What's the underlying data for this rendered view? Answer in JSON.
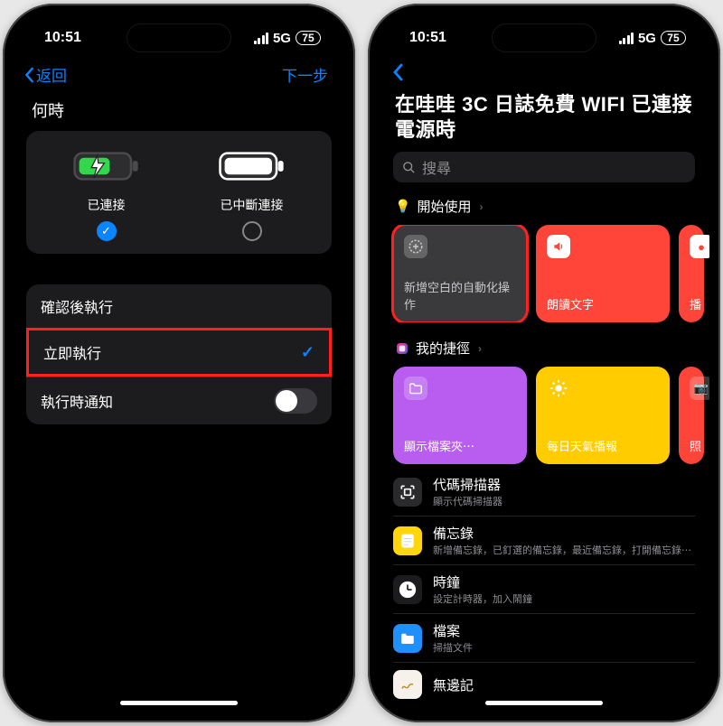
{
  "status": {
    "time": "10:51",
    "network": "5G",
    "battery": "75"
  },
  "left": {
    "back": "返回",
    "next": "下一步",
    "when": "何時",
    "connected": "已連接",
    "disconnected": "已中斷連接",
    "row_confirm": "確認後執行",
    "row_immediate": "立即執行",
    "row_notify": "執行時通知"
  },
  "right": {
    "title": "在哇哇 3C 日誌免費 WIFI 已連接電源時",
    "search_placeholder": "搜尋",
    "sec_start": "開始使用",
    "tile_blank": "新增空白的自動化操作",
    "tile_read": "朗讀文字",
    "tile_broadcast": "播",
    "sec_shortcuts": "我的捷徑",
    "tile_folder": "顯示檔案夾⋯",
    "tile_weather": "每日天氣播報",
    "tile_photo": "照",
    "apps": [
      {
        "name": "代碼掃描器",
        "sub": "顯示代碼掃描器",
        "bg": "#2a2a2c",
        "glyph": "scan"
      },
      {
        "name": "備忘錄",
        "sub": "新增備忘錄，已釘選的備忘錄，最近備忘錄，打開備忘錄⋯",
        "bg": "#ffd60a",
        "glyph": "note"
      },
      {
        "name": "時鐘",
        "sub": "設定計時器，加入鬧鐘",
        "bg": "#1c1c1e",
        "glyph": "clock"
      },
      {
        "name": "檔案",
        "sub": "掃描文件",
        "bg": "#1e90ff",
        "glyph": "files"
      },
      {
        "name": "無邊記",
        "sub": "",
        "bg": "#f6f2eb",
        "glyph": "freeform"
      }
    ]
  }
}
